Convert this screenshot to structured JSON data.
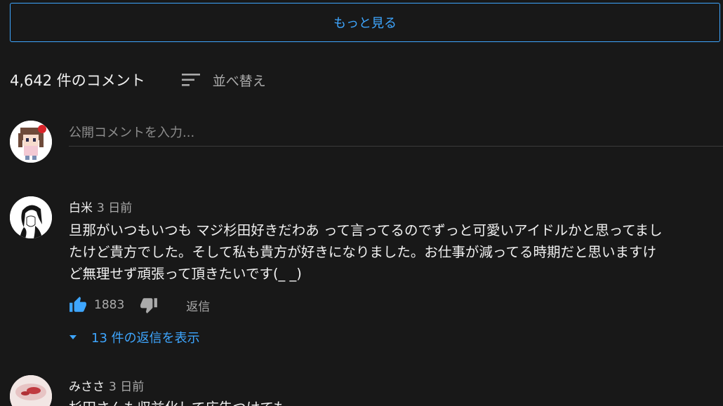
{
  "show_more": {
    "label": "もっと見る"
  },
  "header": {
    "count_text": "4,642 件のコメント",
    "sort_label": "並べ替え"
  },
  "composer": {
    "placeholder": "公開コメントを入力..."
  },
  "comments": [
    {
      "author": "白米",
      "time": "3 日前",
      "text_lines": [
        "旦那がいつもいつも マジ杉田好きだわあ って言ってるのでずっと可愛いアイドルかと思ってまし",
        "たけど貴方でした。そして私も貴方が好きになりました。お仕事が減ってる時期だと思いますけ",
        "ど無理せず頑張って頂きたいです(_ _)"
      ],
      "likes": "1883",
      "reply_label": "返信",
      "view_replies": "13 件の返信を表示"
    },
    {
      "author": "みささ",
      "time": "3 日前",
      "text_lines": [
        "杉田さんも収益化して広告つけても"
      ]
    }
  ],
  "colors": {
    "accent": "#3ea6ff",
    "background": "#181818",
    "text_primary": "#f1f1f1",
    "text_secondary": "#aaaaaa"
  },
  "icons": {
    "sort": "sort-icon",
    "like": "thumb-up-icon",
    "dislike": "thumb-down-icon",
    "caret": "caret-down-icon"
  }
}
